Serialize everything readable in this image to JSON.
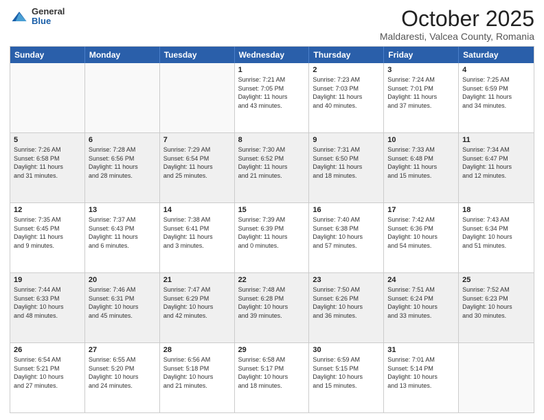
{
  "header": {
    "logo_general": "General",
    "logo_blue": "Blue",
    "month_title": "October 2025",
    "location": "Maldaresti, Valcea County, Romania"
  },
  "weekdays": [
    "Sunday",
    "Monday",
    "Tuesday",
    "Wednesday",
    "Thursday",
    "Friday",
    "Saturday"
  ],
  "rows": [
    {
      "shaded": false,
      "cells": [
        {
          "day": "",
          "empty": true,
          "info": ""
        },
        {
          "day": "",
          "empty": true,
          "info": ""
        },
        {
          "day": "",
          "empty": true,
          "info": ""
        },
        {
          "day": "1",
          "empty": false,
          "info": "Sunrise: 7:21 AM\nSunset: 7:05 PM\nDaylight: 11 hours\nand 43 minutes."
        },
        {
          "day": "2",
          "empty": false,
          "info": "Sunrise: 7:23 AM\nSunset: 7:03 PM\nDaylight: 11 hours\nand 40 minutes."
        },
        {
          "day": "3",
          "empty": false,
          "info": "Sunrise: 7:24 AM\nSunset: 7:01 PM\nDaylight: 11 hours\nand 37 minutes."
        },
        {
          "day": "4",
          "empty": false,
          "info": "Sunrise: 7:25 AM\nSunset: 6:59 PM\nDaylight: 11 hours\nand 34 minutes."
        }
      ]
    },
    {
      "shaded": true,
      "cells": [
        {
          "day": "5",
          "empty": false,
          "info": "Sunrise: 7:26 AM\nSunset: 6:58 PM\nDaylight: 11 hours\nand 31 minutes."
        },
        {
          "day": "6",
          "empty": false,
          "info": "Sunrise: 7:28 AM\nSunset: 6:56 PM\nDaylight: 11 hours\nand 28 minutes."
        },
        {
          "day": "7",
          "empty": false,
          "info": "Sunrise: 7:29 AM\nSunset: 6:54 PM\nDaylight: 11 hours\nand 25 minutes."
        },
        {
          "day": "8",
          "empty": false,
          "info": "Sunrise: 7:30 AM\nSunset: 6:52 PM\nDaylight: 11 hours\nand 21 minutes."
        },
        {
          "day": "9",
          "empty": false,
          "info": "Sunrise: 7:31 AM\nSunset: 6:50 PM\nDaylight: 11 hours\nand 18 minutes."
        },
        {
          "day": "10",
          "empty": false,
          "info": "Sunrise: 7:33 AM\nSunset: 6:48 PM\nDaylight: 11 hours\nand 15 minutes."
        },
        {
          "day": "11",
          "empty": false,
          "info": "Sunrise: 7:34 AM\nSunset: 6:47 PM\nDaylight: 11 hours\nand 12 minutes."
        }
      ]
    },
    {
      "shaded": false,
      "cells": [
        {
          "day": "12",
          "empty": false,
          "info": "Sunrise: 7:35 AM\nSunset: 6:45 PM\nDaylight: 11 hours\nand 9 minutes."
        },
        {
          "day": "13",
          "empty": false,
          "info": "Sunrise: 7:37 AM\nSunset: 6:43 PM\nDaylight: 11 hours\nand 6 minutes."
        },
        {
          "day": "14",
          "empty": false,
          "info": "Sunrise: 7:38 AM\nSunset: 6:41 PM\nDaylight: 11 hours\nand 3 minutes."
        },
        {
          "day": "15",
          "empty": false,
          "info": "Sunrise: 7:39 AM\nSunset: 6:39 PM\nDaylight: 11 hours\nand 0 minutes."
        },
        {
          "day": "16",
          "empty": false,
          "info": "Sunrise: 7:40 AM\nSunset: 6:38 PM\nDaylight: 10 hours\nand 57 minutes."
        },
        {
          "day": "17",
          "empty": false,
          "info": "Sunrise: 7:42 AM\nSunset: 6:36 PM\nDaylight: 10 hours\nand 54 minutes."
        },
        {
          "day": "18",
          "empty": false,
          "info": "Sunrise: 7:43 AM\nSunset: 6:34 PM\nDaylight: 10 hours\nand 51 minutes."
        }
      ]
    },
    {
      "shaded": true,
      "cells": [
        {
          "day": "19",
          "empty": false,
          "info": "Sunrise: 7:44 AM\nSunset: 6:33 PM\nDaylight: 10 hours\nand 48 minutes."
        },
        {
          "day": "20",
          "empty": false,
          "info": "Sunrise: 7:46 AM\nSunset: 6:31 PM\nDaylight: 10 hours\nand 45 minutes."
        },
        {
          "day": "21",
          "empty": false,
          "info": "Sunrise: 7:47 AM\nSunset: 6:29 PM\nDaylight: 10 hours\nand 42 minutes."
        },
        {
          "day": "22",
          "empty": false,
          "info": "Sunrise: 7:48 AM\nSunset: 6:28 PM\nDaylight: 10 hours\nand 39 minutes."
        },
        {
          "day": "23",
          "empty": false,
          "info": "Sunrise: 7:50 AM\nSunset: 6:26 PM\nDaylight: 10 hours\nand 36 minutes."
        },
        {
          "day": "24",
          "empty": false,
          "info": "Sunrise: 7:51 AM\nSunset: 6:24 PM\nDaylight: 10 hours\nand 33 minutes."
        },
        {
          "day": "25",
          "empty": false,
          "info": "Sunrise: 7:52 AM\nSunset: 6:23 PM\nDaylight: 10 hours\nand 30 minutes."
        }
      ]
    },
    {
      "shaded": false,
      "cells": [
        {
          "day": "26",
          "empty": false,
          "info": "Sunrise: 6:54 AM\nSunset: 5:21 PM\nDaylight: 10 hours\nand 27 minutes."
        },
        {
          "day": "27",
          "empty": false,
          "info": "Sunrise: 6:55 AM\nSunset: 5:20 PM\nDaylight: 10 hours\nand 24 minutes."
        },
        {
          "day": "28",
          "empty": false,
          "info": "Sunrise: 6:56 AM\nSunset: 5:18 PM\nDaylight: 10 hours\nand 21 minutes."
        },
        {
          "day": "29",
          "empty": false,
          "info": "Sunrise: 6:58 AM\nSunset: 5:17 PM\nDaylight: 10 hours\nand 18 minutes."
        },
        {
          "day": "30",
          "empty": false,
          "info": "Sunrise: 6:59 AM\nSunset: 5:15 PM\nDaylight: 10 hours\nand 15 minutes."
        },
        {
          "day": "31",
          "empty": false,
          "info": "Sunrise: 7:01 AM\nSunset: 5:14 PM\nDaylight: 10 hours\nand 13 minutes."
        },
        {
          "day": "",
          "empty": true,
          "info": ""
        }
      ]
    }
  ]
}
